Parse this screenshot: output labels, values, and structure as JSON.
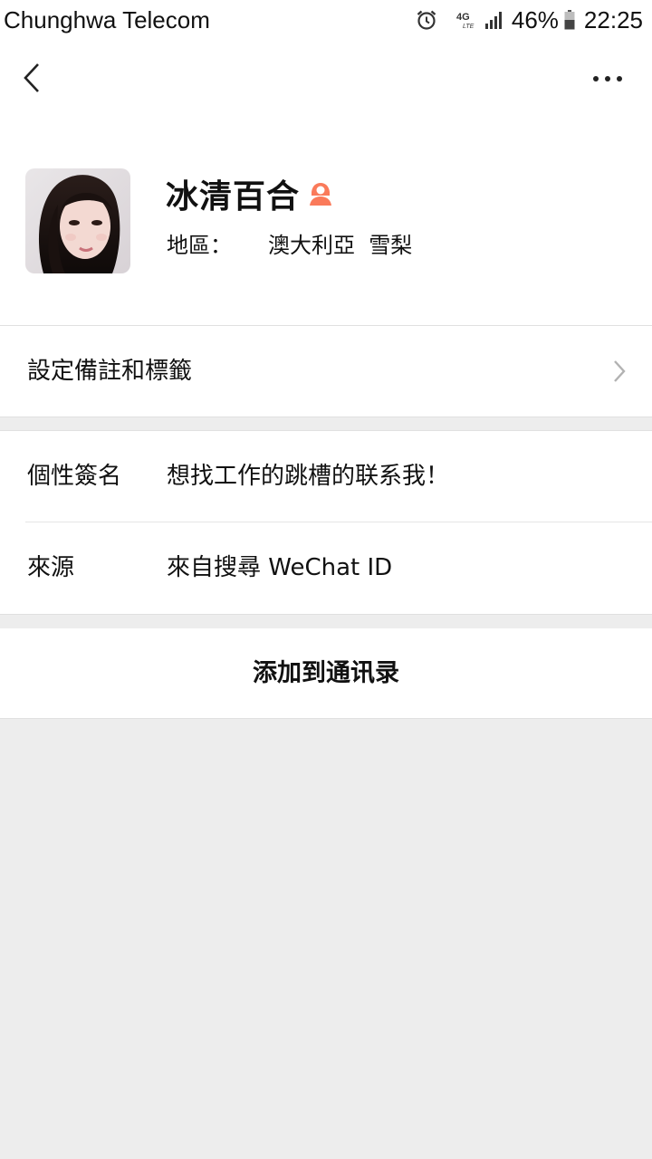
{
  "status_bar": {
    "carrier": "Chunghwa Telecom",
    "network_label": "4G",
    "network_sub": "LTE",
    "battery_percent": "46%",
    "time": "22:25",
    "icons": [
      "alarm-icon",
      "network-4g-icon",
      "signal-icon",
      "battery-icon"
    ]
  },
  "nav": {
    "back_icon": "back-chevron-icon",
    "more_icon": "more-dots-icon"
  },
  "profile": {
    "nickname": "冰清百合",
    "gender_icon": "female-icon",
    "gender_color": "#fa7a5a",
    "region_label": "地區：",
    "region_value": "澳大利亞  雪梨"
  },
  "remark": {
    "label": "設定備註和標籤"
  },
  "info": {
    "signature_label": "個性簽名",
    "signature_value": "想找工作的跳槽的联系我！",
    "source_label": "來源",
    "source_value": "來自搜尋 WeChat ID"
  },
  "actions": {
    "add_contact_label": "添加到通讯录"
  },
  "colors": {
    "background": "#ededed",
    "surface": "#ffffff",
    "text": "#111111",
    "accent": "#fa7a5a"
  }
}
